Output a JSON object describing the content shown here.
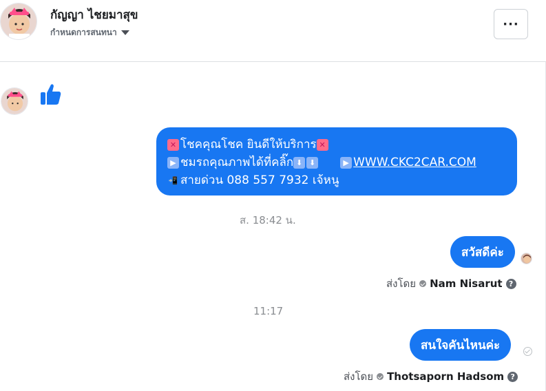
{
  "header": {
    "contact_name": "กัญญา ไชยมาสุข",
    "subtitle": "กำหนดการสนทนา",
    "more_label": "···"
  },
  "messages": {
    "promo": {
      "line1": "โชคคุณโชค ยินดีให้บริการ",
      "line2": "ชมรถคุณภาพได้ที่คลิ๊ก",
      "line2_link": "WWW.CKC2CAR.COM",
      "line3": "สายด่วน 088 557 7932 เจ้หนู"
    },
    "timestamp1": "ส. 18:42 น.",
    "msg1": "สวัสดีค่ะ",
    "sent_by_label": "ส่งโดย",
    "msg1_sender": "Nam Nisarut",
    "timestamp2": "11:17",
    "msg2": "สนใจคันไหนค่ะ",
    "msg2_sender": "Thotsaporn Hadsom"
  },
  "icons": {
    "like": "thumbs-up-icon",
    "more": "more-horizontal-icon",
    "caret": "caret-down-icon",
    "help": "help-icon"
  },
  "colors": {
    "accent": "#1877f2",
    "bubble_text": "#ffffff",
    "muted": "#8a8d91"
  }
}
